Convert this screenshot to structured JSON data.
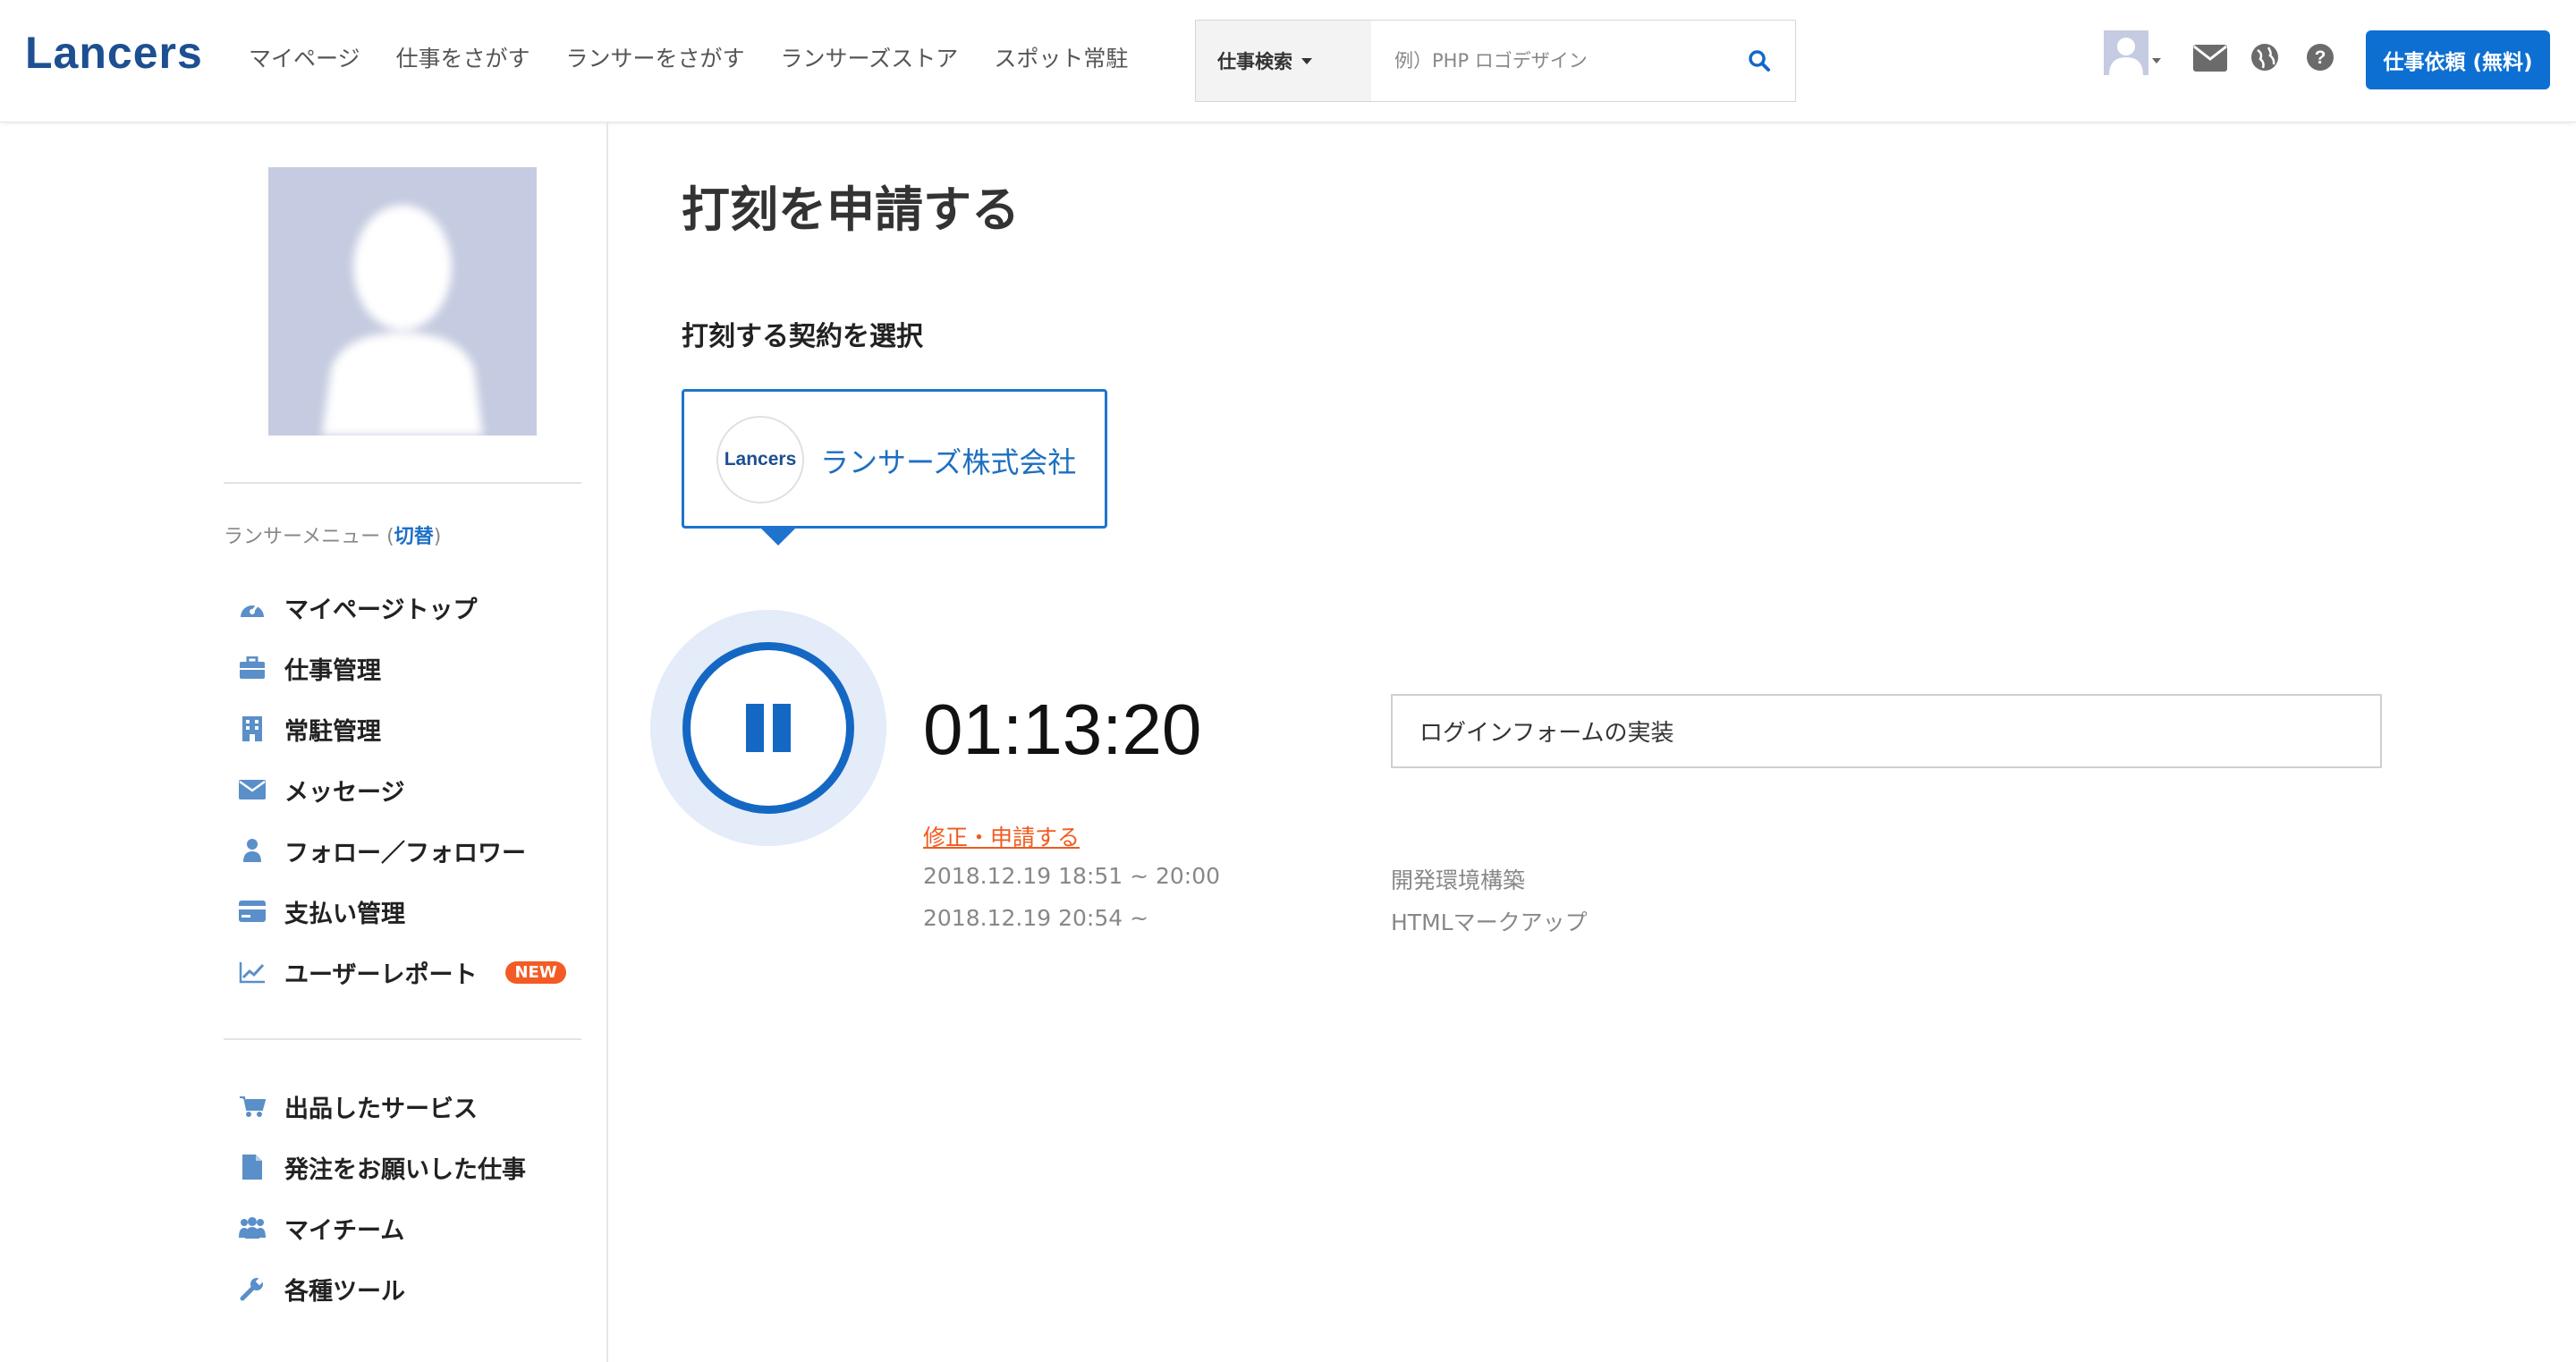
{
  "header": {
    "logo": "Lancers",
    "nav": [
      "マイページ",
      "仕事をさがす",
      "ランサーをさがす",
      "ランサーズストア",
      "スポット常駐"
    ],
    "search": {
      "category": "仕事検索",
      "placeholder": "例）PHP ロゴデザイン",
      "value": ""
    },
    "cta_label": "仕事依頼 (無料)",
    "icons": [
      "avatar-icon",
      "mail-icon",
      "globe-icon",
      "help-icon"
    ]
  },
  "sidebar": {
    "menu_title_prefix": "ランサーメニュー (",
    "menu_switch": "切替",
    "menu_title_suffix": ")",
    "menu": [
      {
        "label": "マイページトップ",
        "icon": "dashboard-icon"
      },
      {
        "label": "仕事管理",
        "icon": "briefcase-icon"
      },
      {
        "label": "常駐管理",
        "icon": "building-icon"
      },
      {
        "label": "メッセージ",
        "icon": "envelope-icon"
      },
      {
        "label": "フォロー／フォロワー",
        "icon": "user-icon"
      },
      {
        "label": "支払い管理",
        "icon": "credit-card-icon"
      },
      {
        "label": "ユーザーレポート",
        "icon": "line-chart-icon",
        "badge": "NEW"
      }
    ],
    "menu2": [
      {
        "label": "出品したサービス",
        "icon": "cart-icon"
      },
      {
        "label": "発注をお願いした仕事",
        "icon": "document-icon"
      },
      {
        "label": "マイチーム",
        "icon": "team-icon"
      },
      {
        "label": "各種ツール",
        "icon": "wrench-icon"
      }
    ]
  },
  "main": {
    "title": "打刻を申請する",
    "section_label": "打刻する契約を選択",
    "contract": {
      "logo_text": "Lancers",
      "company": "ランサーズ株式会社"
    },
    "timer": "01:13:20",
    "task_value": "ログインフォームの実装",
    "edit_link": "修正・申請する",
    "entries": [
      {
        "time": "2018.12.19 18:51 ~ 20:00",
        "task": "開発環境構築"
      },
      {
        "time": "2018.12.19 20:54 ~",
        "task": "HTMLマークアップ"
      }
    ]
  },
  "colors": {
    "brand": "#1d4f91",
    "accent_blue": "#0d6fd1",
    "link_orange": "#f05a1f",
    "badge_orange": "#f35b25",
    "icon_blue": "#5a8fc9"
  }
}
